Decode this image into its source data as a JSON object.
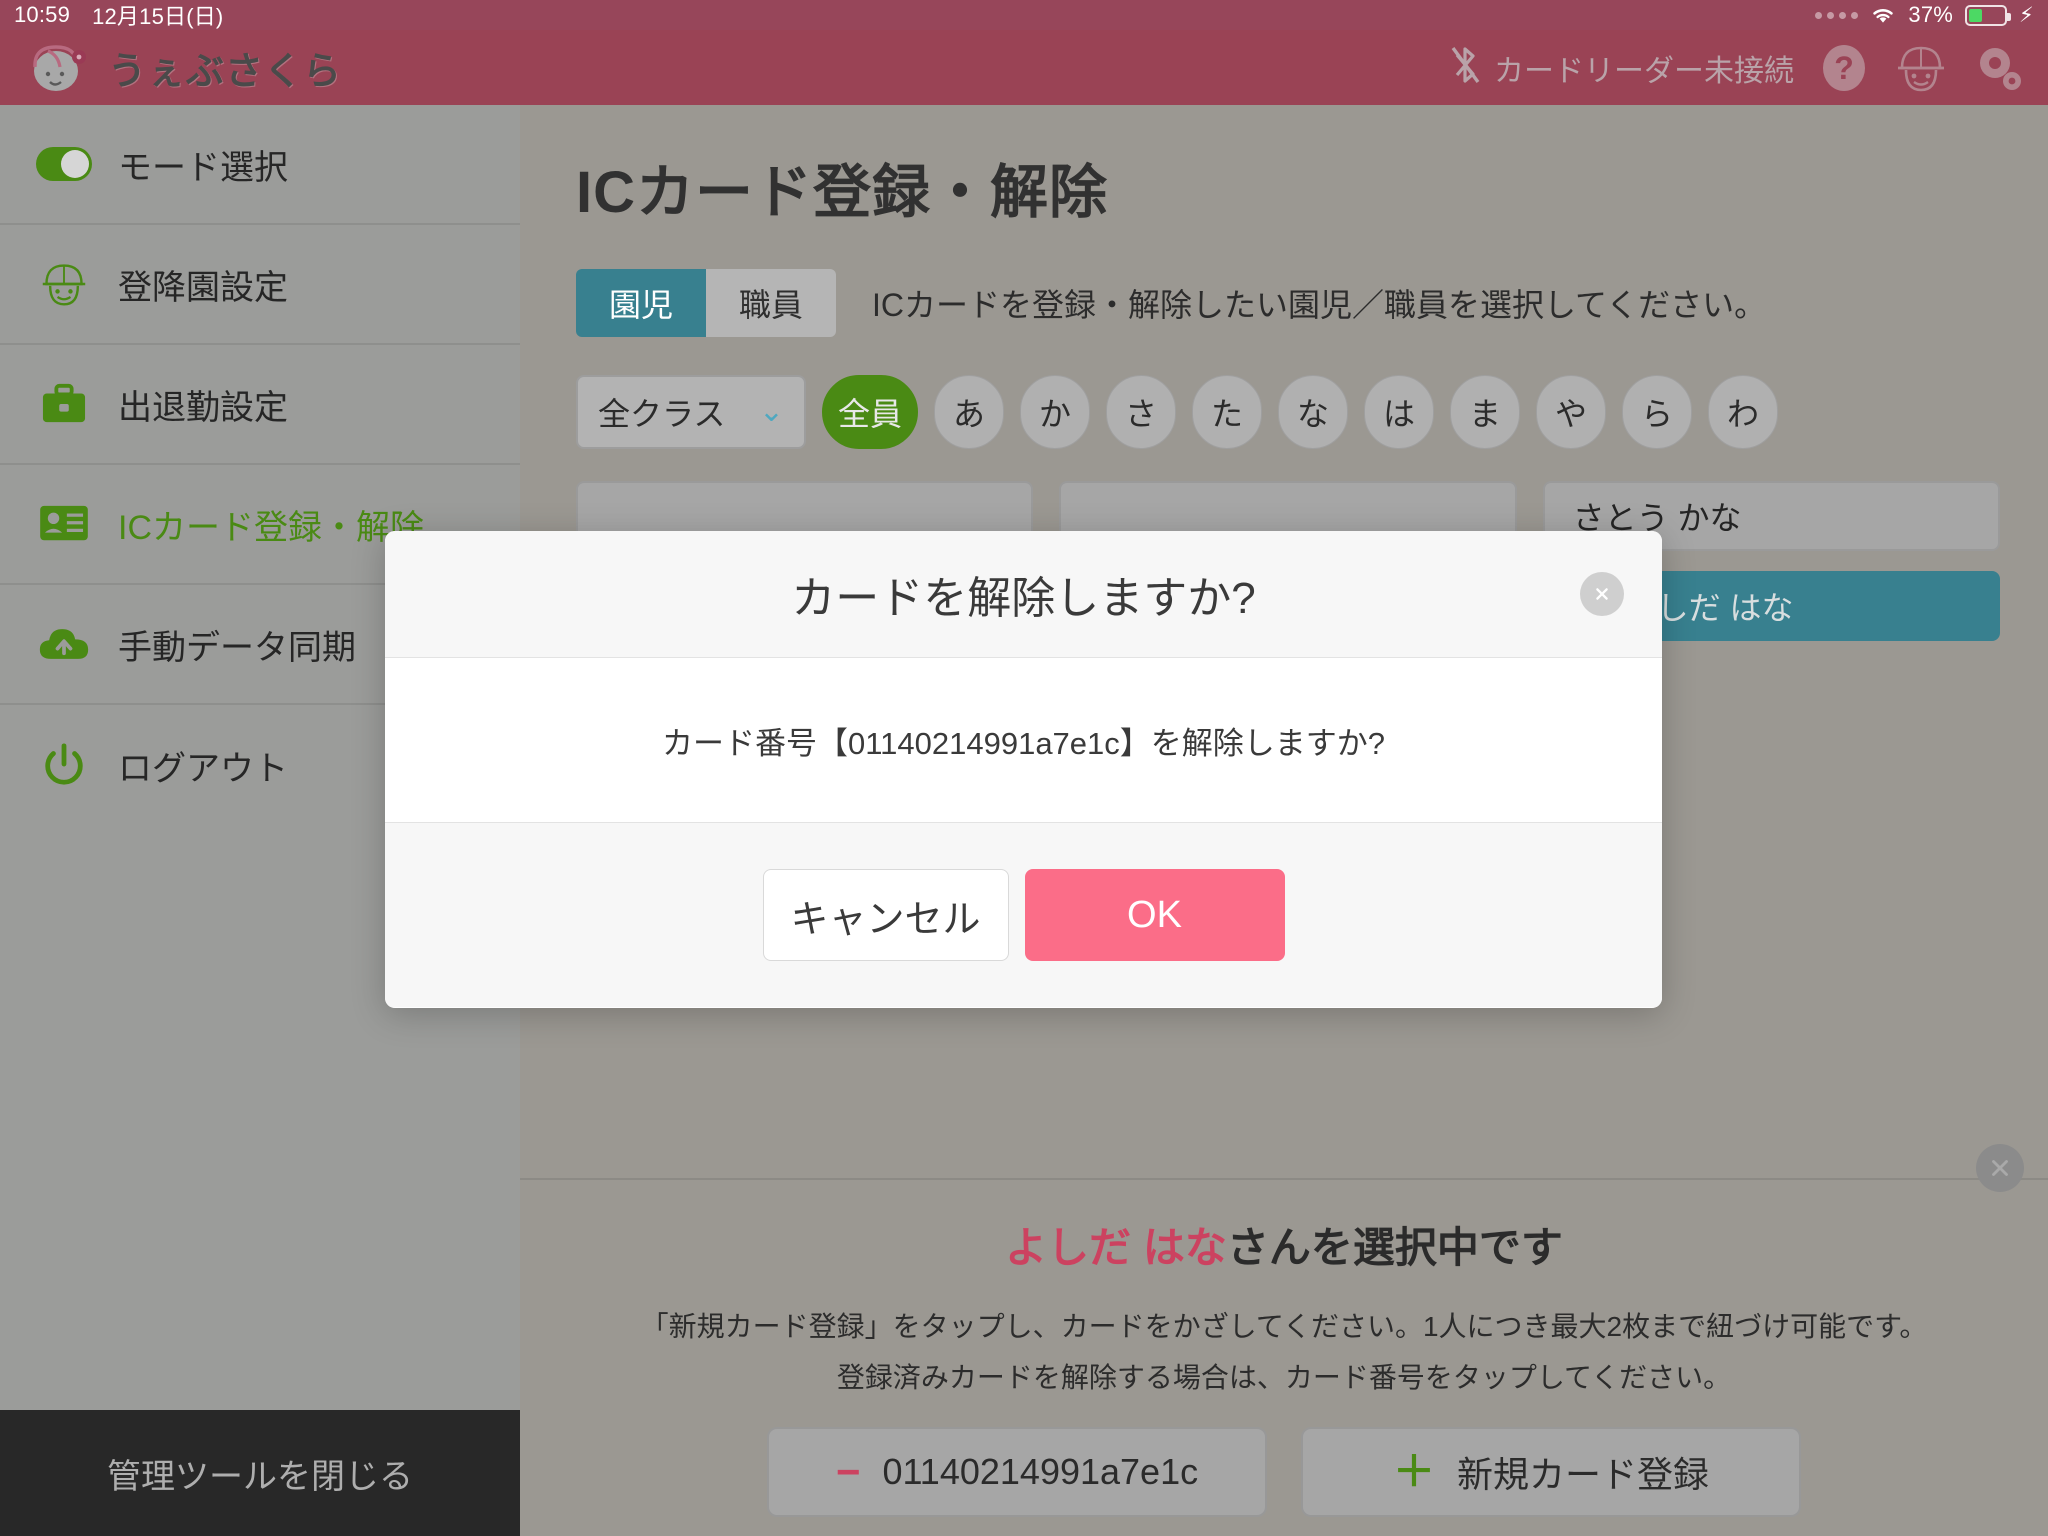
{
  "status_bar": {
    "time": "10:59",
    "date": "12月15日(日)",
    "battery_percent": "37%",
    "battery_level": 37,
    "wifi_icon": "wifi-icon",
    "charging_icon": "lightning-bolt-icon"
  },
  "header": {
    "brand_name": "うぇぶさくら",
    "brand_logo_icon": "sakura-girl-logo-icon",
    "reader_status_text": "カードリーダー未接続",
    "bluetooth_icon": "bluetooth-disabled-icon",
    "help_icon": "help-question-icon",
    "staff_icon": "child-face-icon",
    "settings_icon": "gear-icon",
    "bg_color": "#9a4355"
  },
  "sidebar": {
    "items": [
      {
        "label": "モード選択",
        "icon": "toggle-switch-icon",
        "active": false
      },
      {
        "label": "登降園設定",
        "icon": "child-face-icon",
        "active": false
      },
      {
        "label": "出退勤設定",
        "icon": "briefcase-icon",
        "active": false
      },
      {
        "label": "ICカード登録・解除",
        "icon": "id-card-icon",
        "active": true
      },
      {
        "label": "手動データ同期",
        "icon": "cloud-upload-icon",
        "active": false
      },
      {
        "label": "ログアウト",
        "icon": "power-icon",
        "active": false
      }
    ],
    "close_tool_label": "管理ツールを閉じる",
    "accent_color": "#4a8a14"
  },
  "main": {
    "page_title": "ICカード登録・解除",
    "segment": {
      "options": [
        "園児",
        "職員"
      ],
      "selected": "園児"
    },
    "tab_hint": "ICカードを登録・解除したい園児／職員を選択してください。",
    "class_select": {
      "value": "全クラス",
      "chevron_icon": "chevron-down-icon"
    },
    "kana_filters": [
      "全員",
      "あ",
      "か",
      "さ",
      "た",
      "な",
      "は",
      "ま",
      "や",
      "ら",
      "わ"
    ],
    "kana_selected": "全員",
    "name_cards": [
      {
        "name": "",
        "selected": false
      },
      {
        "name": "",
        "selected": false
      },
      {
        "name": "さとう かな",
        "selected": false
      },
      {
        "name": "",
        "selected": false
      },
      {
        "name": "",
        "selected": false
      },
      {
        "name": "よしだ はな",
        "selected": true,
        "icon": "id-card-icon"
      }
    ]
  },
  "bottom_panel": {
    "selected_name": "よしだ はな",
    "selected_suffix": "さんを選択中です",
    "hint_line_1": "「新規カード登録」をタップし、カードをかざしてください。1人につき最大2枚まで紐づけ可能です。",
    "hint_line_2": "登録済みカードを解除する場合は、カード番号をタップしてください。",
    "registered_card_button": {
      "icon": "minus-icon",
      "label": "01140214991a7e1c"
    },
    "new_card_button": {
      "icon": "plus-icon",
      "label": "新規カード登録"
    },
    "corner_close_icon": "close-x-icon",
    "accent_name_color": "#cc4260"
  },
  "modal": {
    "title": "カードを解除しますか?",
    "close_icon": "close-x-icon",
    "message": "カード番号【01140214991a7e1c】を解除しますか?",
    "cancel_label": "キャンセル",
    "ok_label": "OK",
    "ok_color": "#fb6d88"
  }
}
